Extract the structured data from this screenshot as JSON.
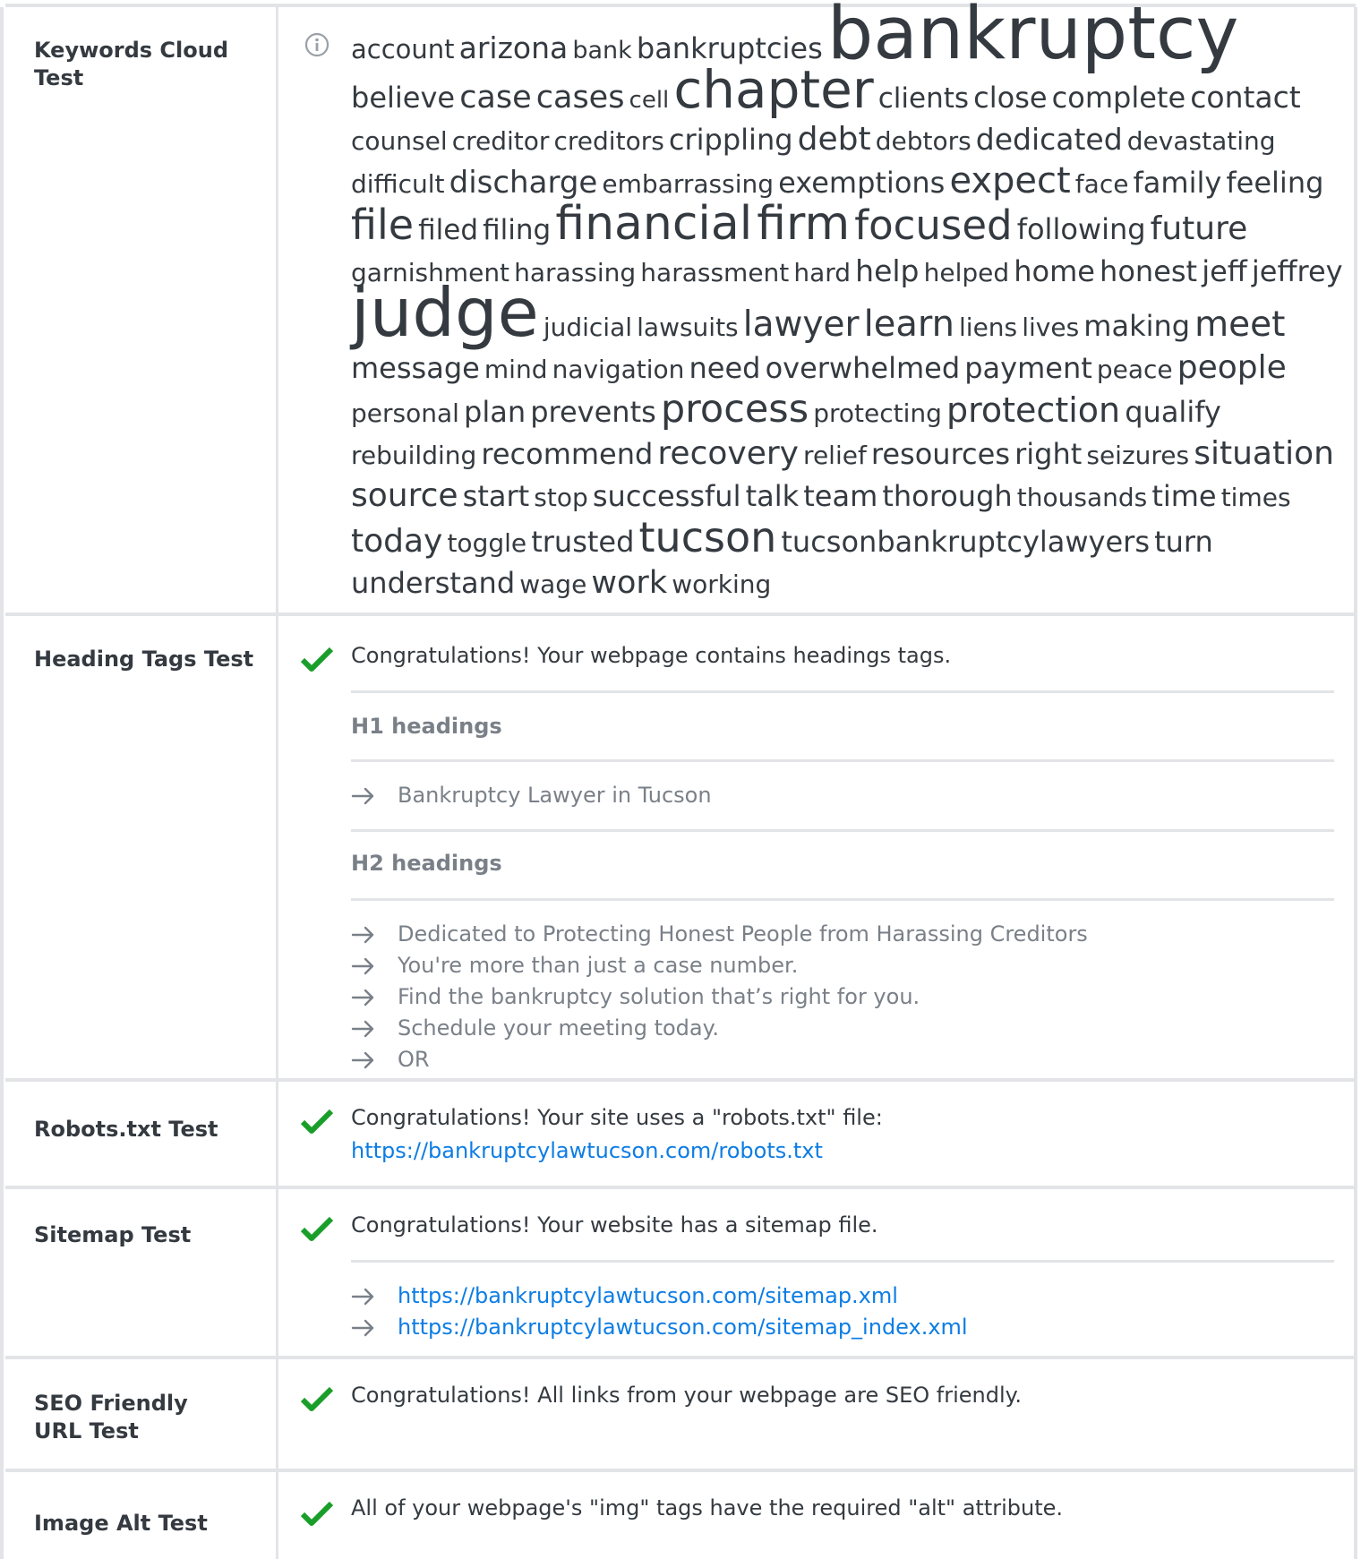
{
  "keywords": {
    "label": "Keywords Cloud Test",
    "words": [
      {
        "text": "account",
        "size": 30
      },
      {
        "text": "arizona",
        "size": 34
      },
      {
        "text": "bank",
        "size": 28
      },
      {
        "text": "bankruptcies",
        "size": 33
      },
      {
        "text": "bankruptcy",
        "size": 84
      },
      {
        "text": "believe",
        "size": 33
      },
      {
        "text": "case",
        "size": 36
      },
      {
        "text": "cases",
        "size": 36
      },
      {
        "text": "cell",
        "size": 27
      },
      {
        "text": "chapter",
        "size": 60
      },
      {
        "text": "clients",
        "size": 32
      },
      {
        "text": "close",
        "size": 33
      },
      {
        "text": "complete",
        "size": 33
      },
      {
        "text": "contact",
        "size": 34
      },
      {
        "text": "counsel",
        "size": 29
      },
      {
        "text": "creditor",
        "size": 29
      },
      {
        "text": "creditors",
        "size": 29
      },
      {
        "text": "crippling",
        "size": 33
      },
      {
        "text": "debt",
        "size": 38
      },
      {
        "text": "debtors",
        "size": 29
      },
      {
        "text": "dedicated",
        "size": 34
      },
      {
        "text": "devastating",
        "size": 29
      },
      {
        "text": "difficult",
        "size": 29
      },
      {
        "text": "discharge",
        "size": 35
      },
      {
        "text": "embarrassing",
        "size": 29
      },
      {
        "text": "exemptions",
        "size": 33
      },
      {
        "text": "expect",
        "size": 42
      },
      {
        "text": "face",
        "size": 29
      },
      {
        "text": "family",
        "size": 33
      },
      {
        "text": "feeling",
        "size": 33
      },
      {
        "text": "file",
        "size": 48
      },
      {
        "text": "filed",
        "size": 32
      },
      {
        "text": "filing",
        "size": 32
      },
      {
        "text": "financial",
        "size": 54
      },
      {
        "text": "firm",
        "size": 54
      },
      {
        "text": "focused",
        "size": 47
      },
      {
        "text": "following",
        "size": 33
      },
      {
        "text": "future",
        "size": 38
      },
      {
        "text": "garnishment",
        "size": 29
      },
      {
        "text": "harassing",
        "size": 29
      },
      {
        "text": "harassment",
        "size": 29
      },
      {
        "text": "hard",
        "size": 29
      },
      {
        "text": "help",
        "size": 34
      },
      {
        "text": "helped",
        "size": 29
      },
      {
        "text": "home",
        "size": 33
      },
      {
        "text": "honest",
        "size": 33
      },
      {
        "text": "jeff",
        "size": 33
      },
      {
        "text": "jeffrey",
        "size": 33
      },
      {
        "text": "judge",
        "size": 78
      },
      {
        "text": "judicial",
        "size": 29
      },
      {
        "text": "lawsuits",
        "size": 29
      },
      {
        "text": "lawyer",
        "size": 41
      },
      {
        "text": "learn",
        "size": 42
      },
      {
        "text": "liens",
        "size": 29
      },
      {
        "text": "lives",
        "size": 29
      },
      {
        "text": "making",
        "size": 33
      },
      {
        "text": "meet",
        "size": 41
      },
      {
        "text": "message",
        "size": 33
      },
      {
        "text": "mind",
        "size": 29
      },
      {
        "text": "navigation",
        "size": 29
      },
      {
        "text": "need",
        "size": 33
      },
      {
        "text": "overwhelmed",
        "size": 33
      },
      {
        "text": "payment",
        "size": 33
      },
      {
        "text": "peace",
        "size": 29
      },
      {
        "text": "people",
        "size": 38
      },
      {
        "text": "personal",
        "size": 29
      },
      {
        "text": "plan",
        "size": 33
      },
      {
        "text": "prevents",
        "size": 33
      },
      {
        "text": "process",
        "size": 45
      },
      {
        "text": "protecting",
        "size": 29
      },
      {
        "text": "protection",
        "size": 40
      },
      {
        "text": "qualify",
        "size": 33
      },
      {
        "text": "rebuilding",
        "size": 29
      },
      {
        "text": "recommend",
        "size": 33
      },
      {
        "text": "recovery",
        "size": 37
      },
      {
        "text": "relief",
        "size": 29
      },
      {
        "text": "resources",
        "size": 33
      },
      {
        "text": "right",
        "size": 33
      },
      {
        "text": "seizures",
        "size": 29
      },
      {
        "text": "situation",
        "size": 37
      },
      {
        "text": "source",
        "size": 37
      },
      {
        "text": "start",
        "size": 33
      },
      {
        "text": "stop",
        "size": 29
      },
      {
        "text": "successful",
        "size": 33
      },
      {
        "text": "talk",
        "size": 33
      },
      {
        "text": "team",
        "size": 33
      },
      {
        "text": "thorough",
        "size": 33
      },
      {
        "text": "thousands",
        "size": 29
      },
      {
        "text": "time",
        "size": 33
      },
      {
        "text": "times",
        "size": 29
      },
      {
        "text": "today",
        "size": 38
      },
      {
        "text": "toggle",
        "size": 29
      },
      {
        "text": "trusted",
        "size": 33
      },
      {
        "text": "tucson",
        "size": 48
      },
      {
        "text": "tucsonbankruptcylawyers",
        "size": 33
      },
      {
        "text": "turn",
        "size": 33
      },
      {
        "text": "understand",
        "size": 33
      },
      {
        "text": "wage",
        "size": 29
      },
      {
        "text": "work",
        "size": 36
      },
      {
        "text": "working",
        "size": 29
      }
    ]
  },
  "headings": {
    "label": "Heading Tags Test",
    "message": "Congratulations! Your webpage contains headings tags.",
    "h1_title": "H1 headings",
    "h1": [
      "Bankruptcy Lawyer in Tucson"
    ],
    "h2_title": "H2 headings",
    "h2": [
      "Dedicated to Protecting Honest People from Harassing Creditors",
      "You're more than just a case number.",
      "Find the bankruptcy solution that’s right for you.",
      "Schedule your meeting today.",
      "OR"
    ]
  },
  "robots": {
    "label": "Robots.txt Test",
    "message": "Congratulations! Your site uses a \"robots.txt\" file:",
    "url": "https://bankruptcylawtucson.com/robots.txt"
  },
  "sitemap": {
    "label": "Sitemap Test",
    "message": "Congratulations! Your website has a sitemap file.",
    "urls": [
      "https://bankruptcylawtucson.com/sitemap.xml",
      "https://bankruptcylawtucson.com/sitemap_index.xml"
    ]
  },
  "seo_url": {
    "label": "SEO Friendly URL Test",
    "message": "Congratulations! All links from your webpage are SEO friendly."
  },
  "image_alt": {
    "label": "Image Alt Test",
    "message": "All of your webpage's \"img\" tags have the required \"alt\" attribute."
  },
  "colors": {
    "text": "#343a40",
    "muted": "#7a8088",
    "link": "#0d7de4",
    "check": "#1a9e2a",
    "border": "#e2e4e7"
  }
}
